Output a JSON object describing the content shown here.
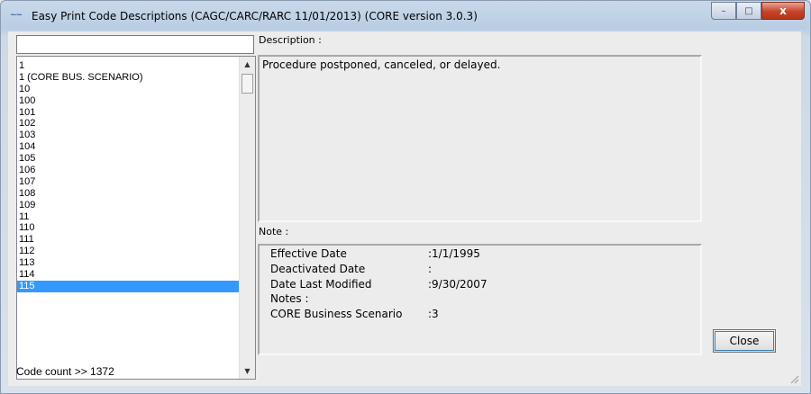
{
  "window": {
    "title": "Easy Print Code Descriptions (CAGC/CARC/RARC 11/01/2013) (CORE version 3.0.3)",
    "icon": "app-icon",
    "controls": {
      "minimize": "–",
      "maximize": "□",
      "close": "x"
    }
  },
  "search": {
    "value": ""
  },
  "codes": {
    "items": [
      "1",
      "1 (CORE BUS. SCENARIO)",
      "10",
      "100",
      "101",
      "102",
      "103",
      "104",
      "105",
      "106",
      "107",
      "108",
      "109",
      "11",
      "110",
      "111",
      "112",
      "113",
      "114",
      "115"
    ],
    "selected": "115",
    "count_label": "Code count >> 1372"
  },
  "description": {
    "label": "Description :",
    "text": "Procedure postponed, canceled, or delayed."
  },
  "note": {
    "label": "Note :",
    "rows": [
      {
        "key": "Effective Date",
        "value": ":1/1/1995"
      },
      {
        "key": "Deactivated Date",
        "value": ":"
      },
      {
        "key": "Date Last Modified",
        "value": ":9/30/2007"
      },
      {
        "key": "Notes :",
        "value": ""
      },
      {
        "key": "CORE Business Scenario",
        "value": ":3"
      }
    ]
  },
  "buttons": {
    "close": "Close"
  }
}
